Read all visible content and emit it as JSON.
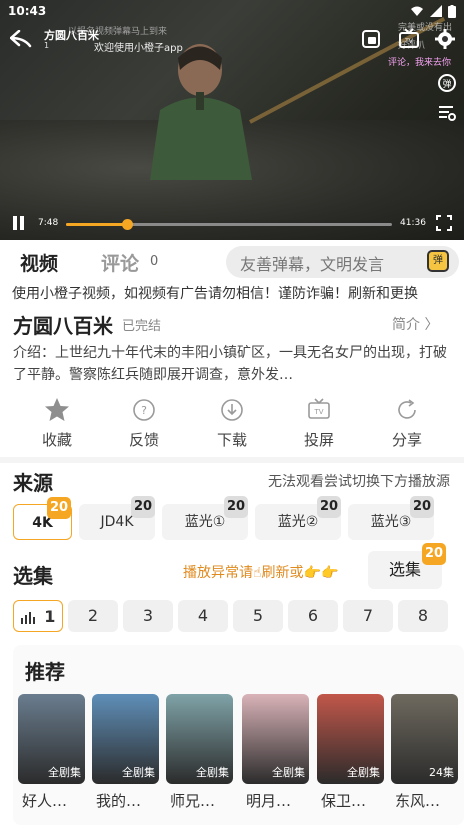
{
  "status": {
    "time": "10:43"
  },
  "video": {
    "title": "方圆八百米",
    "episode": "1",
    "welcome": "欢迎使用小橙子app",
    "danmu": [
      "以报名视频弹幕马上到来",
      "完美或没有出",
      "好评叭",
      "评论，我来去你"
    ],
    "current_time": "7:48",
    "duration": "41:36",
    "progress": 0.187
  },
  "tabs": {
    "video": "视频",
    "comments": "评论",
    "comments_count": "0"
  },
  "danmu_input": {
    "placeholder": "友善弹幕，文明发言",
    "button": "弹"
  },
  "notice": "使用小橙子视频，如视频有广告请勿相信！谨防诈骗！刷新和更换",
  "show": {
    "title": "方圆八百米",
    "status": "已完结",
    "intro_link": "简介 〉",
    "description": "介绍：上世纪九十年代末的丰阳小镇矿区，一具无名女尸的出现，打破了平静。警察陈红兵随即展开调查，意外发…"
  },
  "actions": [
    {
      "label": "收藏",
      "icon": "star-icon"
    },
    {
      "label": "反馈",
      "icon": "feedback-icon"
    },
    {
      "label": "下载",
      "icon": "download-icon"
    },
    {
      "label": "投屏",
      "icon": "cast-icon"
    },
    {
      "label": "分享",
      "icon": "share-icon"
    }
  ],
  "sources": {
    "heading": "来源",
    "tip": "无法观看尝试切换下方播放源",
    "items": [
      {
        "label": "4K",
        "badge": "20"
      },
      {
        "label": "JD4K",
        "badge": "20"
      },
      {
        "label": "蓝光①",
        "badge": "20"
      },
      {
        "label": "蓝光②",
        "badge": "20"
      },
      {
        "label": "蓝光③",
        "badge": "20"
      }
    ]
  },
  "episodes": {
    "heading": "选集",
    "tip": "播放异常请☝刷新或👉👉",
    "select": "选集",
    "select_badge": "20",
    "items": [
      "1",
      "2",
      "3",
      "4",
      "5",
      "6",
      "7",
      "8"
    ]
  },
  "recommend": {
    "heading": "推荐",
    "items": [
      {
        "name": "好人…",
        "tag": "全剧集",
        "color": "#6a7d8f"
      },
      {
        "name": "我的…",
        "tag": "全剧集",
        "color": "#5f8fb8"
      },
      {
        "name": "师兄…",
        "tag": "全剧集",
        "color": "#7fa3a8"
      },
      {
        "name": "明月…",
        "tag": "全剧集",
        "color": "#d9b3b8"
      },
      {
        "name": "保卫…",
        "tag": "全剧集",
        "color": "#c2574a"
      },
      {
        "name": "东风…",
        "tag": "24集",
        "color": "#6f6a5f"
      }
    ]
  }
}
